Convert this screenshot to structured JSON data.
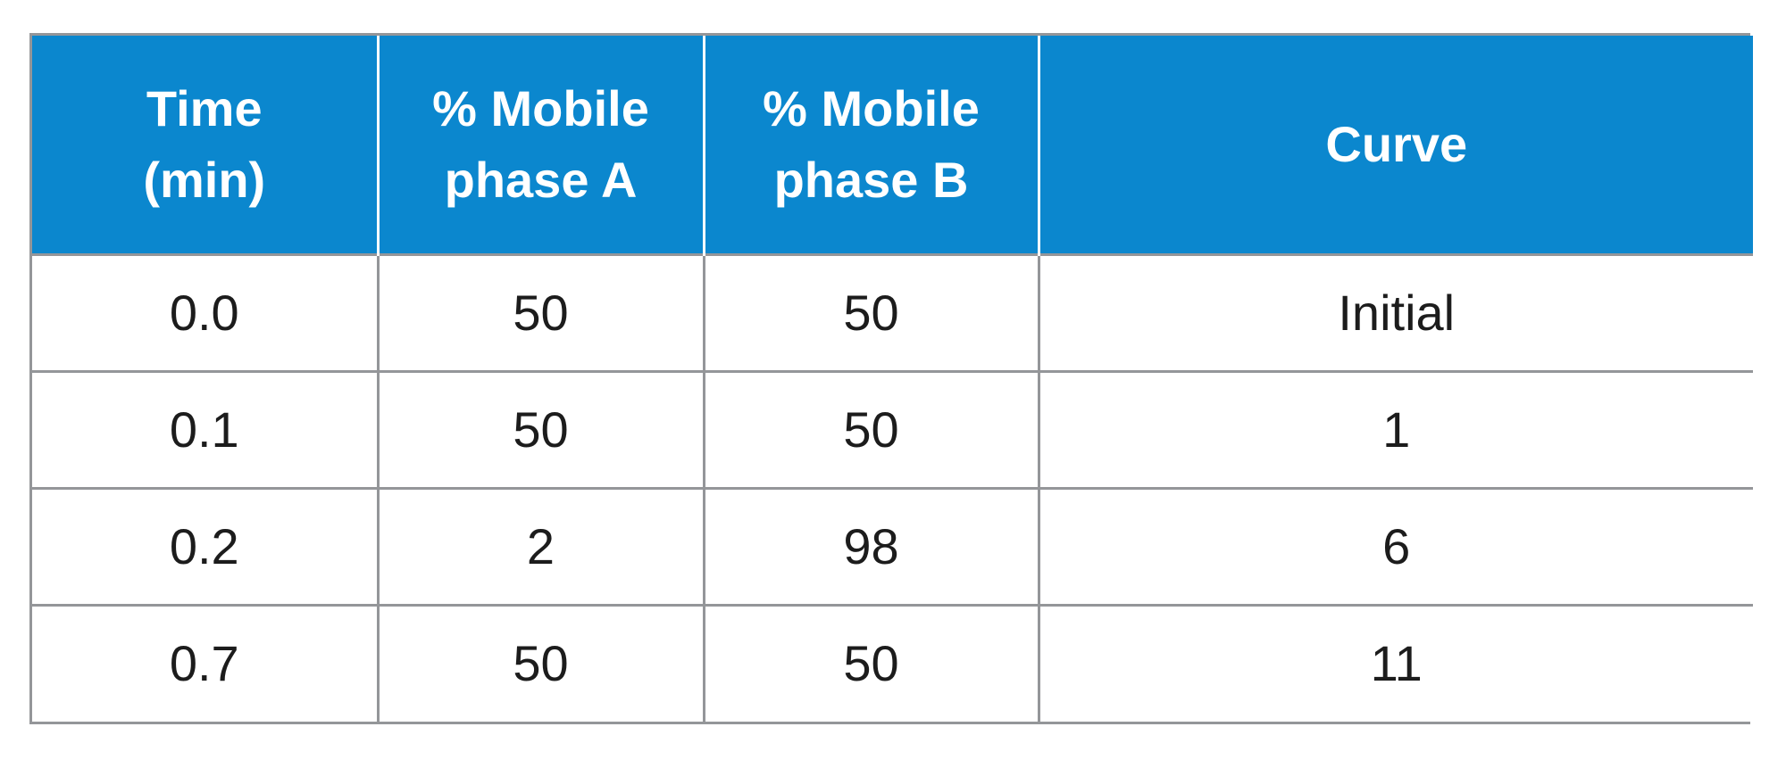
{
  "table": {
    "columns": [
      {
        "id": "time",
        "lines": [
          "Time",
          "(min)"
        ]
      },
      {
        "id": "mpa",
        "lines": [
          "% Mobile",
          "phase A"
        ]
      },
      {
        "id": "mpb",
        "lines": [
          "% Mobile",
          "phase B"
        ]
      },
      {
        "id": "curve",
        "lines": [
          "Curve"
        ]
      }
    ],
    "rows": [
      {
        "time": "0.0",
        "mpa": "50",
        "mpb": "50",
        "curve": "Initial"
      },
      {
        "time": "0.1",
        "mpa": "50",
        "mpb": "50",
        "curve": "1"
      },
      {
        "time": "0.2",
        "mpa": "2",
        "mpb": "98",
        "curve": "6"
      },
      {
        "time": "0.7",
        "mpa": "50",
        "mpb": "50",
        "curve": "11"
      }
    ]
  },
  "chart_data": {
    "type": "table",
    "title": "",
    "categories": [
      "Time (min)",
      "% Mobile phase A",
      "% Mobile phase B",
      "Curve"
    ],
    "columns": [
      "Time (min)",
      "% Mobile phase A",
      "% Mobile phase B",
      "Curve"
    ],
    "rows": [
      [
        "0.0",
        "50",
        "50",
        "Initial"
      ],
      [
        "0.1",
        "50",
        "50",
        "1"
      ],
      [
        "0.2",
        "2",
        "98",
        "6"
      ],
      [
        "0.7",
        "50",
        "50",
        "11"
      ]
    ],
    "series": [
      {
        "name": "Time (min)",
        "values": [
          0.0,
          0.1,
          0.2,
          0.7
        ]
      },
      {
        "name": "% Mobile phase A",
        "values": [
          50,
          50,
          2,
          50
        ]
      },
      {
        "name": "% Mobile phase B",
        "values": [
          50,
          50,
          98,
          50
        ]
      },
      {
        "name": "Curve",
        "values": [
          "Initial",
          1,
          6,
          11
        ]
      }
    ],
    "xlabel": "",
    "ylabel": "",
    "grid": true,
    "legend": "none"
  },
  "style": {
    "header_bg": "#0b87ce",
    "header_text": "#ffffff",
    "border": "#949699",
    "body_text": "#1c1c1c",
    "body_bg": "#ffffff"
  }
}
